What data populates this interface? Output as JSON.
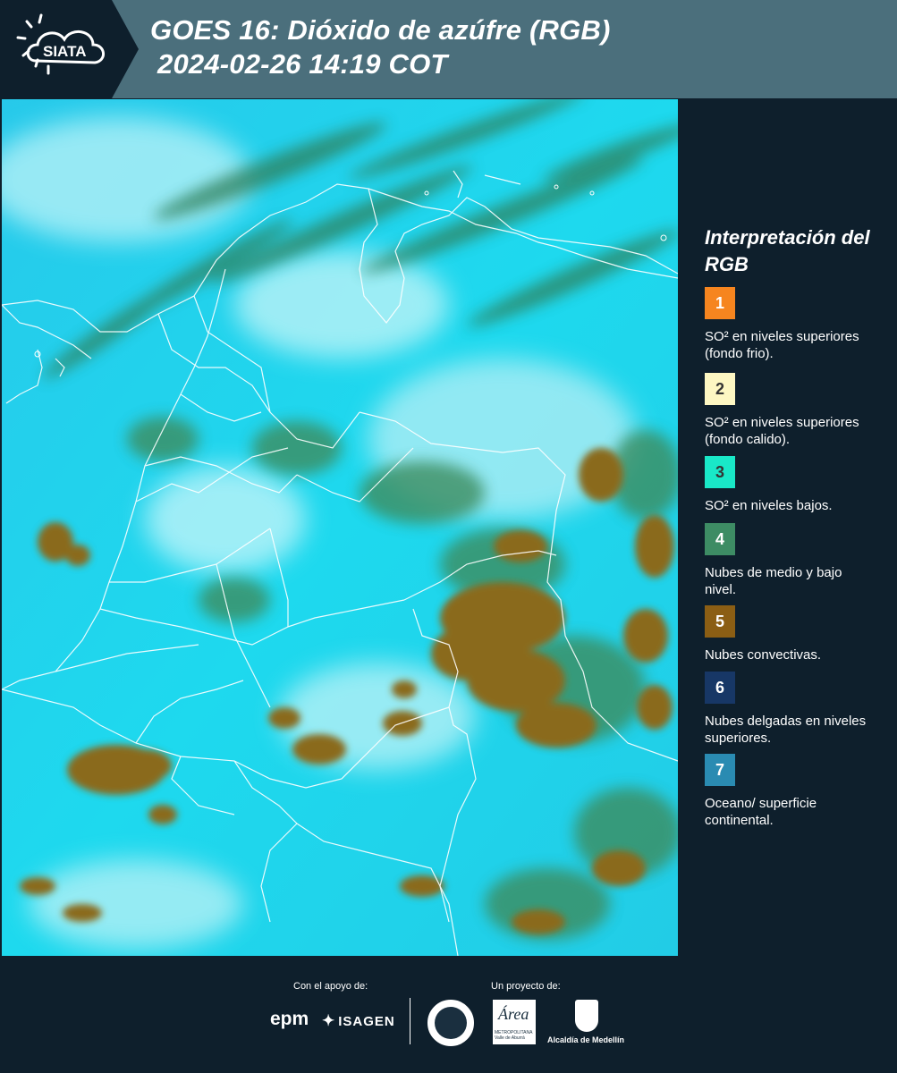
{
  "header": {
    "title_line1": "GOES 16: Dióxido de azúfre (RGB)",
    "title_line2": "2024-02-26 14:19 COT",
    "logo_text": "SIATA",
    "background_color": "#4b6f7c"
  },
  "map": {
    "product": "SO2 RGB",
    "dominant_colors": [
      "#1dd6ee",
      "#8a6a1e",
      "#3f8a5c",
      "#b9f0f5"
    ]
  },
  "legend": {
    "title": "Interpretación del RGB",
    "items": [
      {
        "number": "1",
        "color": "#f6851f",
        "number_color": "#ffffff",
        "label": "SO² en niveles superiores (fondo frio)."
      },
      {
        "number": "2",
        "color": "#fdf7c3",
        "number_color": "#333333",
        "label": "SO² en niveles superiores (fondo calido)."
      },
      {
        "number": "3",
        "color": "#19e8c8",
        "number_color": "#333333",
        "label": "SO² en niveles bajos."
      },
      {
        "number": "4",
        "color": "#3d8c64",
        "number_color": "#ffffff",
        "label": "Nubes de medio y bajo nivel."
      },
      {
        "number": "5",
        "color": "#8b5e14",
        "number_color": "#ffffff",
        "label": "Nubes convectivas."
      },
      {
        "number": "6",
        "color": "#173766",
        "number_color": "#ffffff",
        "label": "Nubes delgadas en niveles superiores."
      },
      {
        "number": "7",
        "color": "#2a8bb2",
        "number_color": "#ffffff",
        "label": "Oceano/ superficie continental."
      }
    ]
  },
  "footer": {
    "support_caption": "Con el apoyo de:",
    "project_caption": "Un proyecto de:",
    "sponsors": [
      "epm",
      "ISAGEN"
    ],
    "epm_text": "epm",
    "isagen_text": "ISAGEN",
    "area_logo_text": "Área",
    "area_logo_subtext": "METROPOLITANA Valle de Aburrá",
    "alcaldia_label": "Alcaldía de Medellín"
  }
}
